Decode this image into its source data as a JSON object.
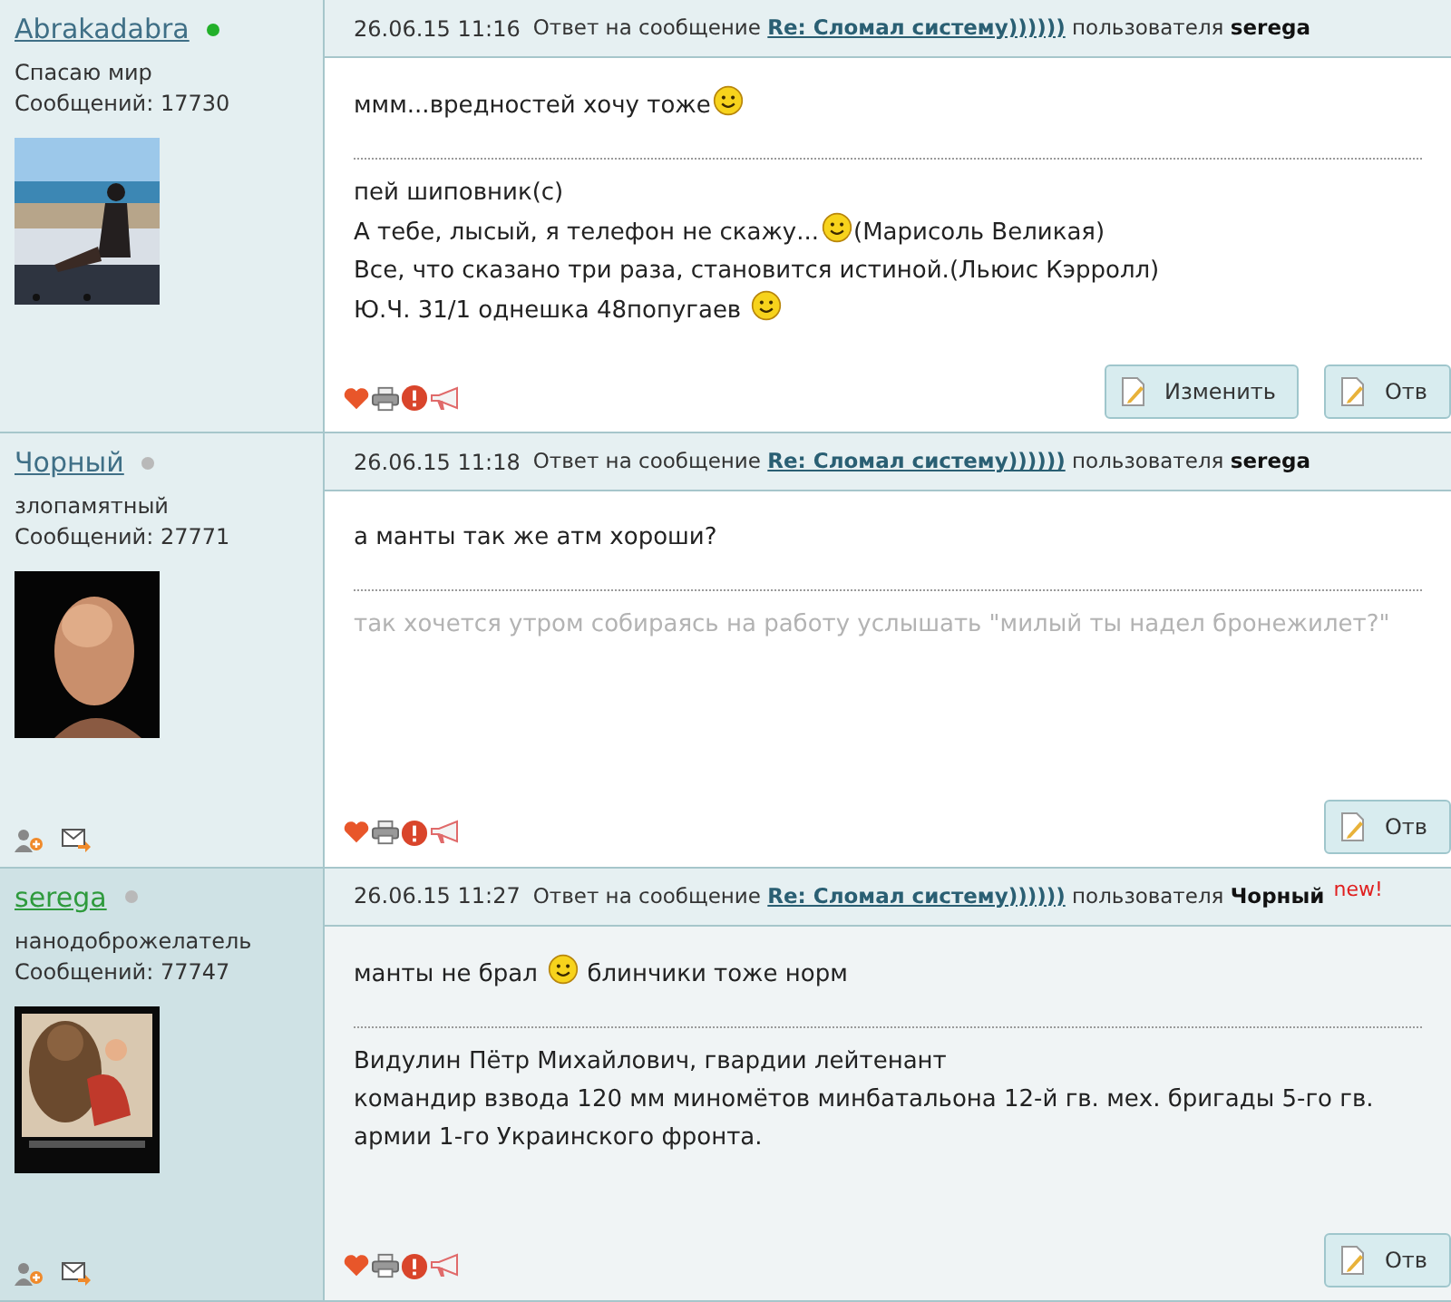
{
  "posts": [
    {
      "author": {
        "name": "Abrakadabra",
        "color": "#3f6f86",
        "online": true,
        "status": "Спасаю мир",
        "count": "Сообщений: 17730",
        "avatar": {
          "kind": "beach"
        },
        "contact_icons": false
      },
      "highlighted": false,
      "header": {
        "date": "26.06.15 11:16",
        "before": "Ответ на сообщение",
        "link": "Re: Сломал систему))))))",
        "middle": "пользователя",
        "user": "serega"
      },
      "message": [
        [
          {
            "kind": "text",
            "text": "ммм...вредностей хочу тоже"
          },
          {
            "kind": "smiley"
          }
        ]
      ],
      "signature": {
        "muted": false,
        "lines": [
          [
            {
              "kind": "text",
              "text": "пей шиповник(с)"
            }
          ],
          [
            {
              "kind": "text",
              "text": "А тебе, лысый, я телефон не скажу..."
            },
            {
              "kind": "smiley"
            },
            {
              "kind": "text",
              "text": "(Марисоль Великая)"
            }
          ],
          [
            {
              "kind": "text",
              "text": "Все, что сказано три раза, становится истиной.(Льюис Кэрролл)"
            }
          ],
          [
            {
              "kind": "text",
              "text": "Ю.Ч. 31/1 однешка 48попугаев "
            },
            {
              "kind": "smiley"
            }
          ]
        ]
      },
      "buttons": [
        "Изменить",
        "Отв"
      ]
    },
    {
      "author": {
        "name": "Чорный",
        "color": "#3f6f86",
        "online": false,
        "status": "злопамятный",
        "count": "Сообщений: 27771",
        "avatar": {
          "kind": "portrait"
        },
        "contact_icons": true
      },
      "highlighted": false,
      "header": {
        "date": "26.06.15 11:18",
        "before": "Ответ на сообщение",
        "link": "Re: Сломал систему))))))",
        "middle": "пользователя",
        "user": "serega"
      },
      "message": [
        [
          {
            "kind": "text",
            "text": "а манты так же атм хороши?"
          }
        ]
      ],
      "signature": {
        "muted": true,
        "lines": [
          [
            {
              "kind": "text",
              "text": "так хочется утром собираясь на работу услышать \"милый ты надел бронежилет?\""
            }
          ]
        ]
      },
      "buttons": [
        "Отв"
      ]
    },
    {
      "author": {
        "name": "serega",
        "color": "#2e9a3c",
        "online": false,
        "status": "нанодоброжелатель",
        "count": "Сообщений: 77747",
        "avatar": {
          "kind": "poster"
        },
        "contact_icons": true
      },
      "highlighted": true,
      "header": {
        "date": "26.06.15 11:27",
        "before": "Ответ на сообщение",
        "link": "Re: Сломал систему))))))",
        "middle": "пользователя",
        "user": "Чорный",
        "badge": "new!"
      },
      "message": [
        [
          {
            "kind": "text",
            "text": "манты не брал "
          },
          {
            "kind": "smiley"
          },
          {
            "kind": "text",
            "text": " блинчики тоже норм"
          }
        ]
      ],
      "signature": {
        "muted": false,
        "lines": [
          [
            {
              "kind": "text",
              "text": "Видулин Пётр Михайлович, гвардии лейтенант"
            }
          ],
          [
            {
              "kind": "text",
              "text": "командир взвода 120 мм миномётов минбатальона 12-й гв. мех. бригады 5-го гв."
            }
          ],
          [
            {
              "kind": "text",
              "text": "армии 1-го Украинского фронта."
            }
          ]
        ]
      },
      "buttons": [
        "Отв"
      ]
    }
  ]
}
